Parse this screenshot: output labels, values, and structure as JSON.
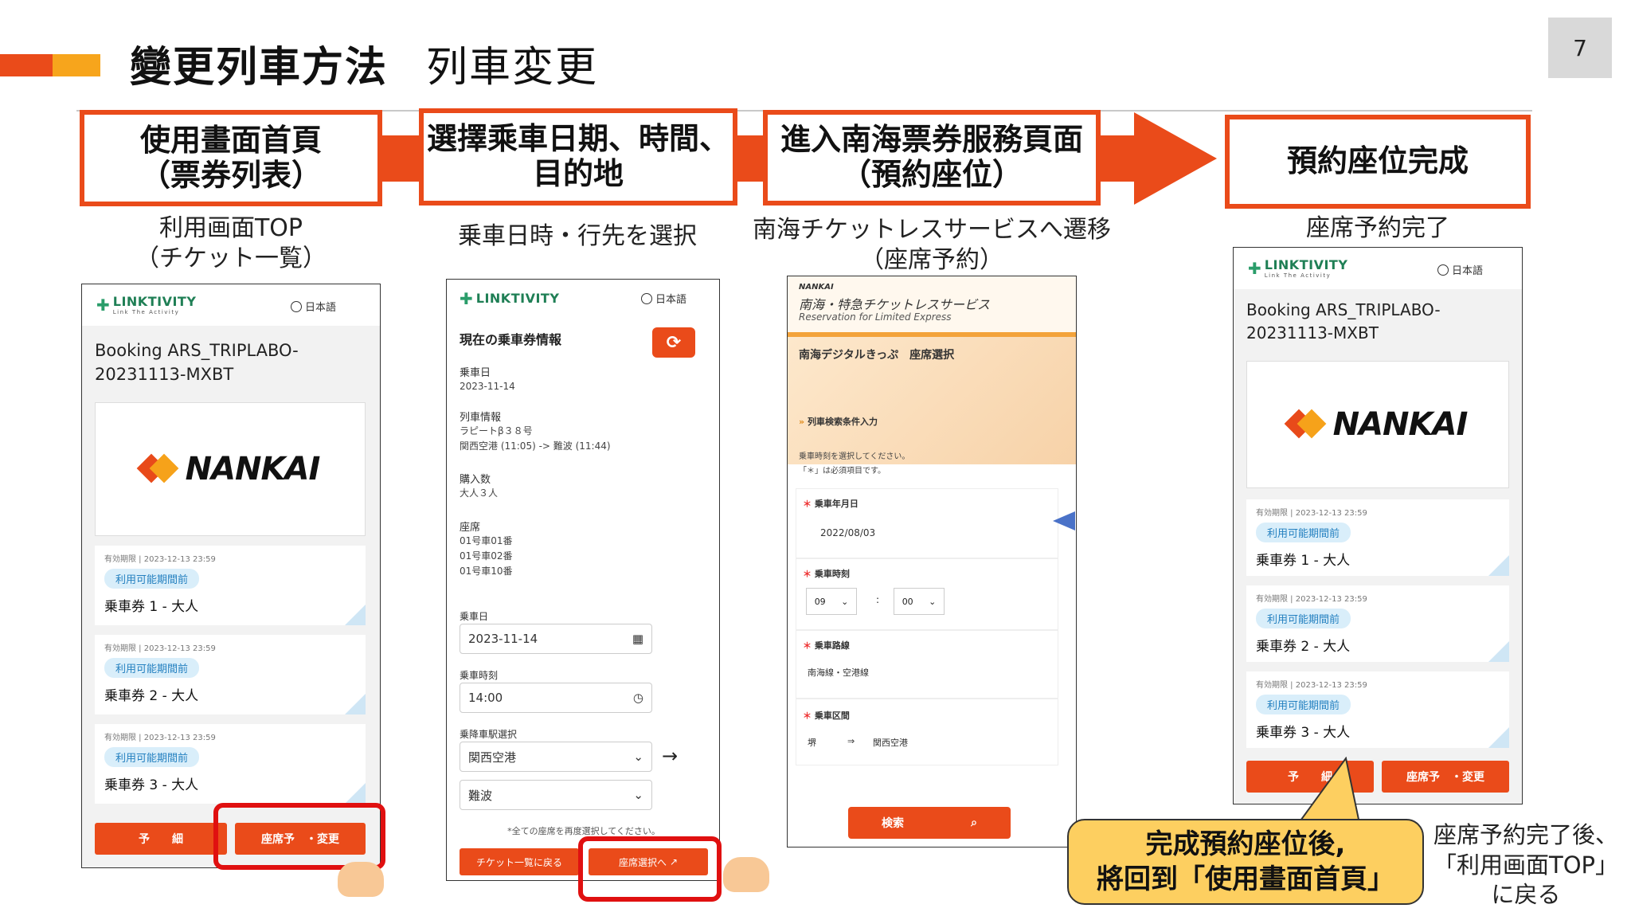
{
  "header": {
    "title": "變更列車方法",
    "subtitle": "列車変更",
    "page_number": "7"
  },
  "steps": [
    {
      "line1": "使用畫面首頁",
      "line2": "（票券列表）"
    },
    {
      "line1": "選擇乘車日期、時間、",
      "line2": "目的地"
    },
    {
      "line1": "進入南海票券服務頁面",
      "line2": "（預約座位）"
    },
    {
      "line1": "預約座位完成"
    }
  ],
  "captions": [
    {
      "line1": "利用画面TOP",
      "line2": "（チケット一覧）"
    },
    {
      "line1": "乗車日時・行先を選択"
    },
    {
      "line1": "南海チケットレスサービスへ遷移",
      "line2": "（座席予約）"
    },
    {
      "line1": "座席予約完了"
    }
  ],
  "app": {
    "logo": "LINKTIVITY",
    "logo_sub": "Link The Activity",
    "lang": "日本語",
    "booking_line1": "Booking ARS_TRIPLABO-",
    "booking_line2": "20231113-MXBT",
    "brand": "NANKAI",
    "tickets": [
      {
        "expiry": "有効期限 | 2023-12-13 23:59",
        "status": "利用可能期間前",
        "name": "乗車券 1 - 大人"
      },
      {
        "expiry": "有効期限 | 2023-12-13 23:59",
        "status": "利用可能期間前",
        "name": "乗車券 2 - 大人"
      },
      {
        "expiry": "有効期限 | 2023-12-13 23:59",
        "status": "利用可能期間前",
        "name": "乗車券 3 - 大人"
      }
    ],
    "btn_detail": "予　　細",
    "btn_seat": "座席予　・変更",
    "btn_detail_p4": "予　　細",
    "btn_seat_p4": "座席予　・変更"
  },
  "phone2": {
    "section_title": "現在の乗車券情報",
    "date_label": "乗車日",
    "date_value": "2023-11-14",
    "train_label": "列車情報",
    "train_name": "ラピートβ３８号",
    "train_route": "関西空港 (11:05) -> 難波 (11:44)",
    "count_label": "購入数",
    "count_value": "大人３人",
    "seat_label": "座席",
    "seats": [
      "01号車01番",
      "01号車02番",
      "01号車10番"
    ],
    "in_date_label": "乗車日",
    "in_date_value": "2023-11-14",
    "in_time_label": "乗車時刻",
    "in_time_value": "14:00",
    "station_label": "乗降車駅選択",
    "from_station": "関西空港",
    "to_station": "難波",
    "note": "*全ての座席を再度選択してください。",
    "btn_back": "チケット一覧に戻る",
    "btn_seat_select": "座席選択へ"
  },
  "phone3": {
    "brand_small": "NANKAI",
    "service_title": "南海・特急チケットレスサービス",
    "service_sub": "Reservation for Limited Express",
    "nav": "南海デジタルきっぷ　座席選択",
    "section": "列車検索条件入力",
    "instruction1": "乗車時刻を選択してください。",
    "instruction2": "「＊」は必須項目です。",
    "date_label": "乗車年月日",
    "date_value": "2022/08/03",
    "time_label": "乗車時刻",
    "hour": "09",
    "colon": ":",
    "minute": "00",
    "route_label": "乗車路線",
    "route_value": "南海線・空港線",
    "section_label": "乗車区間",
    "from": "堺",
    "arrow": "⇒",
    "to": "関西空港",
    "search_btn": "検索"
  },
  "callout": {
    "line1": "完成預約座位後,",
    "line2": "將回到「使用畫面首頁」"
  },
  "side_note": {
    "line1": "座席予約完了後、",
    "line2": "「利用画面TOP」",
    "line3": "に戻る"
  },
  "colors": {
    "accent": "#ea4b1a",
    "yellow": "#f7a51c",
    "highlight": "#e01010",
    "callout": "#fdcf60",
    "green": "#1f7f55"
  }
}
